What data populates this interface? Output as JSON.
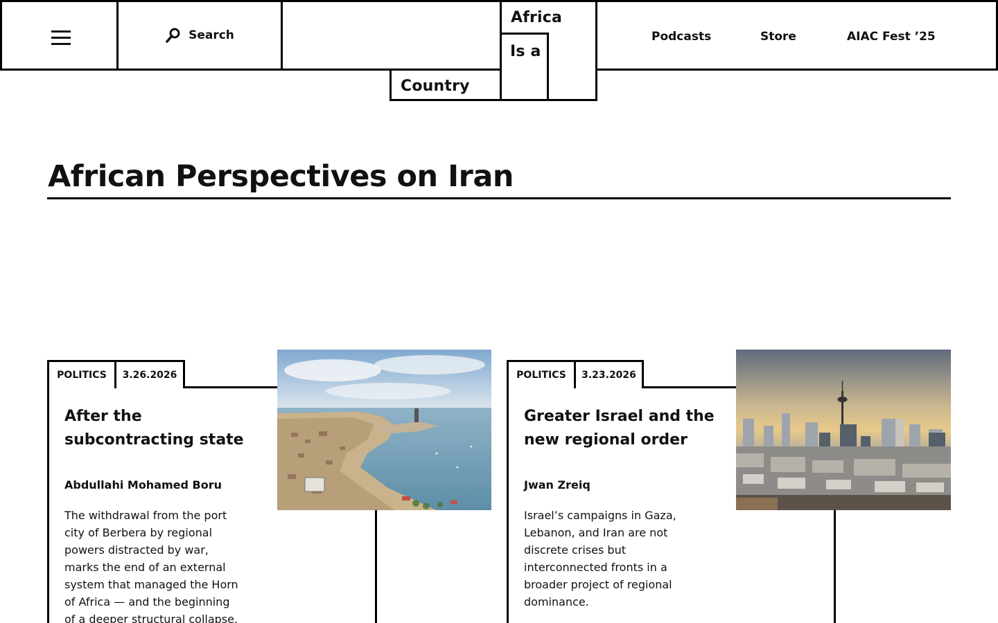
{
  "header": {
    "menu_icon": "hamburger-icon",
    "search_label": "Search",
    "search_icon": "search-icon",
    "logo": {
      "line1": "Africa",
      "line2": "Is a",
      "line3": "Country"
    },
    "nav": [
      {
        "label": "Podcasts"
      },
      {
        "label": "Store"
      },
      {
        "label": "AIAC Fest ’25"
      }
    ]
  },
  "page": {
    "title": "African Perspectives on Iran"
  },
  "articles": [
    {
      "category": "POLITICS",
      "date": "3.26.2026",
      "title_line1": "After the",
      "title_line2": "subcontracting state",
      "author": "Abdullahi Mohamed Boru",
      "desc_lines": [
        "The withdrawal from the port",
        "city of Berbera by regional",
        "powers distracted by war,",
        "marks the end of an external",
        "system that managed the Horn",
        "of Africa — and the beginning",
        "of a deeper structural collapse."
      ],
      "image": "aerial-coastal-port-photo"
    },
    {
      "category": "POLITICS",
      "date": "3.23.2026",
      "title_line1": "Greater Israel and the",
      "title_line2": "new regional order",
      "author": "Jwan Zreiq",
      "desc_lines": [
        "Israel’s campaigns in Gaza,",
        "Lebanon, and Iran are not",
        "discrete crises but",
        "interconnected fronts in a",
        "broader project of regional",
        "dominance."
      ],
      "image": "tehran-skyline-photo"
    }
  ]
}
